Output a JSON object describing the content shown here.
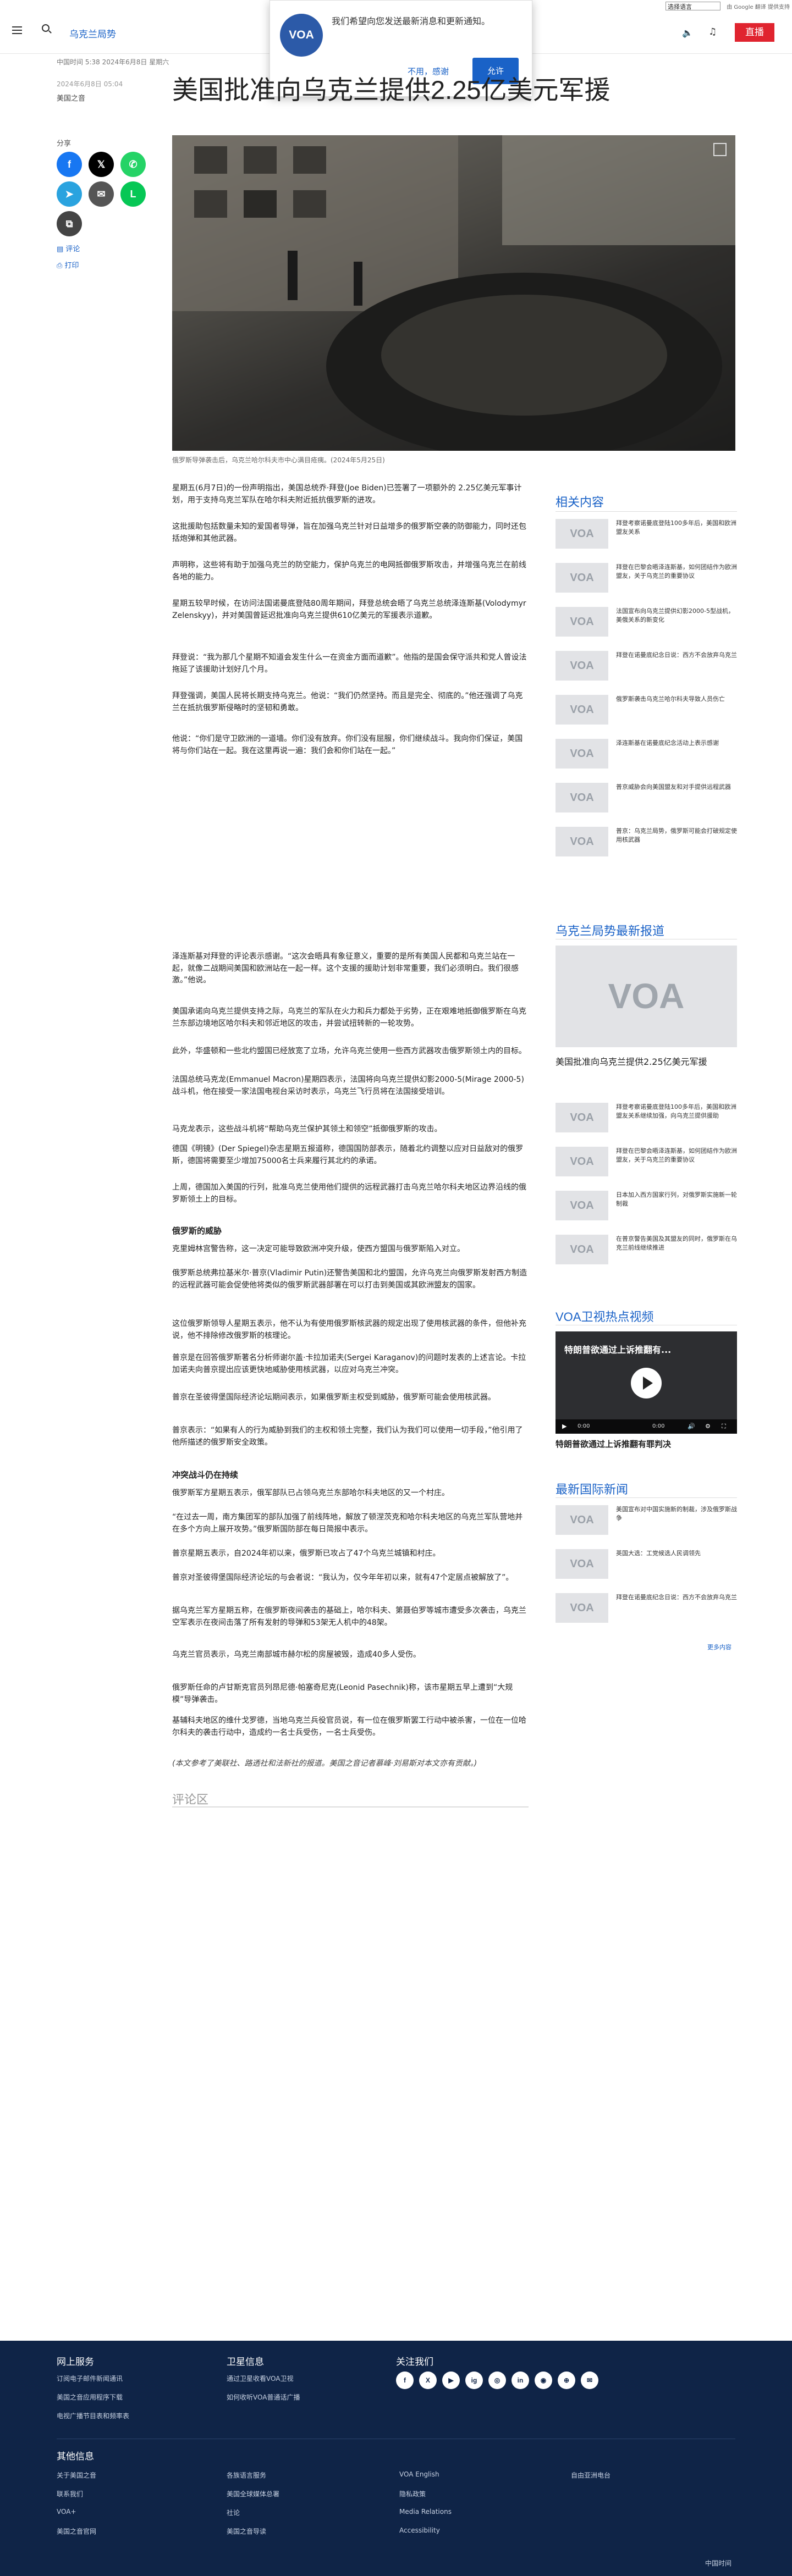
{
  "utility": {
    "language_select": "选择语言",
    "google_translate": "由 Google 翻译 提供支持"
  },
  "header": {
    "section_title": "乌克兰局势",
    "live_label": "直播"
  },
  "notification": {
    "logo": "VOA",
    "message": "我们希望向您发送最新消息和更新通知。",
    "deny_label": "不用，感谢",
    "allow_label": "允许"
  },
  "article": {
    "time_note": "中国时间 5:38 2024年6月8日 星期六",
    "pubdate": "2024年6月8日 05:04",
    "byline": "美国之音",
    "title": "美国批准向乌克兰提供2.25亿美元军援",
    "share_label": "分享",
    "comment_link": "评论",
    "print_link": "打印",
    "image_caption": "俄罗斯导弹袭击后，乌克兰哈尔科夫市中心满目疮痍。(2024年5月25日)",
    "paragraphs_a": [
      "星期五(6月7日)的一份声明指出，美国总统乔·拜登(Joe Biden)已签署了一项额外的 2.25亿美元军事计划，用于支持乌克兰军队在哈尔科夫附近抵抗俄罗斯的进攻。",
      "这批援助包括数量未知的爱国者导弹，旨在加强乌克兰针对日益增多的俄罗斯空袭的防御能力，同时还包括炮弹和其他武器。",
      "声明称，这些将有助于加强乌克兰的防空能力，保护乌克兰的电网抵御俄罗斯攻击，并增强乌克兰在前线各地的能力。",
      "星期五较早时候，在访问法国诺曼底登陆80周年期间，拜登总统会晤了乌克兰总统泽连斯基(Volodymyr Zelenskyy)，并对美国曾延迟批准向乌克兰提供610亿美元的军援表示道歉。",
      "拜登说：“我为那几个星期不知道会发生什么一在资金方面而道歉”。他指的是国会保守派共和党人曾设法拖延了该援助计划好几个月。",
      "拜登强调，美国人民将长期支持乌克兰。他说：“我们仍然坚持。而且是完全、彻底的。”他还强调了乌克兰在抵抗俄罗斯侵略时的坚韧和勇敢。",
      "他说：“你们是守卫欧洲的一道墙。你们没有放弃。你们没有屈服，你们继续战斗。我向你们保证，美国将与你们站在一起。我在这里再说一遍：我们会和你们站在一起。”"
    ],
    "paragraphs_b": [
      "泽连斯基对拜登的评论表示感谢。“这次会晤具有象征意义，重要的是所有美国人民都和乌克兰站在一起，就像二战期间美国和欧洲站在一起一样。这个支援的援助计划非常重要，我们必须明白。我们很感激。”他说。",
      "美国承诺向乌克兰提供支持之际，乌克兰的军队在火力和兵力都处于劣势，正在艰难地抵御俄罗斯在乌克兰东部边境地区哈尔科夫和邻近地区的攻击，并尝试扭转新的一轮攻势。",
      "此外，华盛顿和一些北约盟国已经放宽了立场，允许乌克兰使用一些西方武器攻击俄罗斯领土内的目标。",
      "法国总统马克龙(Emmanuel Macron)星期四表示，法国将向乌克兰提供幻影2000-5(Mirage 2000-5)战斗机，他在接受一家法国电视台采访时表示，乌克兰飞行员将在法国接受培训。",
      "马克龙表示，这些战斗机将“帮助乌克兰保护其领土和领空”抵御俄罗斯的攻击。",
      "德国《明镜》(Der Spiegel)杂志星期五报道称，德国国防部表示，随着北约调整以应对日益敌对的俄罗斯，德国将需要至少增加75000名士兵来履行其北约的承诺。",
      "上周，德国加入美国的行列，批准乌克兰使用他们提供的远程武器打击乌克兰哈尔科夫地区边界沿线的俄罗斯领土上的目标。"
    ],
    "h_threat": "俄罗斯的威胁",
    "paragraphs_c": [
      "克里姆林宫警告称，这一决定可能导致欧洲冲突升级，使西方盟国与俄罗斯陷入对立。",
      "俄罗斯总统弗拉基米尔·普京(Vladimir Putin)还警告美国和北约盟国，允许乌克兰向俄罗斯发射西方制造的远程武器可能会促使他将类似的俄罗斯武器部署在可以打击到美国或其欧洲盟友的国家。",
      "这位俄罗斯领导人星期五表示，他不认为有使用俄罗斯核武器的规定出现了使用核武器的条件，但他补充说，他不排除修改俄罗斯的核理论。",
      "普京是在回答俄罗斯著名分析师谢尔盖·卡拉加诺夫(Sergei Karaganov)的问题时发表的上述言论。卡拉加诺夫向普京提出应该更快地威胁使用核武器，以应对乌克兰冲突。",
      "普京在圣彼得堡国际经济论坛期间表示，如果俄罗斯主权受到威胁，俄罗斯可能会使用核武器。",
      "普京表示：“如果有人的行为威胁到我们的主权和领土完整，我们认为我们可以使用一切手段，”他引用了他所描述的俄罗斯安全政策。"
    ],
    "h_fighting": "冲突战斗仍在持续",
    "paragraphs_d": [
      "俄罗斯军方星期五表示，俄军部队已占领乌克兰东部哈尔科夫地区的又一个村庄。",
      "“在过去一周，南方集团军的部队加强了前线阵地，解放了顿涅茨克和哈尔科夫地区的乌克兰军队营地并在多个方向上展开攻势。”俄罗斯国防部在每日简报中表示。",
      "普京星期五表示，自2024年初以来，俄罗斯已攻占了47个乌克兰城镇和村庄。",
      "普京对圣彼得堡国际经济论坛的与会者说：“我认为，仅今年年初以来，就有47个定居点被解放了”。",
      "据乌克兰军方星期五称，在俄罗斯夜间袭击的基础上，哈尔科夫、第聂伯罗等城市遭受多次袭击，乌克兰空军表示在夜间击落了所有发射的导弹和53架无人机中的48架。",
      "乌克兰官员表示，乌克兰南部城市赫尔松的房屋被毁，造成40多人受伤。",
      "俄罗斯任命的卢甘斯克官员列昂尼德·帕塞奇尼克(Leonid Pasechnik)称，该市星期五早上遭到“大规模”导弹袭击。",
      "基辅科夫地区的维什戈罗德，当地乌克兰兵役官员说，有一位在俄罗斯罢工行动中被杀害，一位在一位哈尔科夫的袭击行动中，造成约一名士兵受伤，一名士兵受伤。"
    ],
    "source_note": "(本文参考了美联社、路透社和法新社的报道。美国之音记者慕峰·刘易斯对本文亦有贡献。)",
    "comments_label": "评论区"
  },
  "sidebar": {
    "related_heading": "相关内容",
    "related": [
      "拜登考察诺曼底登陆100多年后，美国和欧洲盟友关系",
      "拜登在巴黎会晤泽连斯基，如何团结作为欧洲盟友，关于乌克兰的重要协议",
      "法国宣布向乌克兰提供幻影2000-5型战机，美俄关系的新变化",
      "拜登在诺曼底纪念日说：西方不会放弃乌克兰",
      "俄罗斯袭击乌克兰哈尔科夫导致人员伤亡",
      "泽连斯基在诺曼底纪念活动上表示感谢",
      "普京威胁会向美国盟友和对手提供远程武器",
      "普京：乌克兰局势，俄罗斯可能会打破规定使用核武器"
    ],
    "latest_heading": "乌克兰局势最新报道",
    "latest_lead_logo": "VOA",
    "latest_lead_title": "美国批准向乌克兰提供2.25亿美元军援",
    "latest": [
      "拜登考察诺曼底登陆100多年后，美国和欧洲盟友关系继续加强，向乌克兰提供援助",
      "拜登在巴黎会晤泽连斯基，如何团结作为欧洲盟友，关于乌克兰的重要协议",
      "日本加入西方国家行列，对俄罗斯实施新一轮制裁",
      "在普京警告美国及其盟友的同时，俄罗斯在乌克兰前线继续推进"
    ],
    "video_heading": "VOA卫视热点视频",
    "video_title": "特朗普欲通过上诉推翻有...",
    "video_time": "0:00",
    "video_duration": "0:00",
    "video_caption": "特朗普欲通过上诉推翻有罪判决",
    "intl_heading": "最新国际新闻",
    "intl": [
      "美国宣布对中国实施新的制裁，涉及俄罗斯战争",
      "英国大选：工党候选人民调领先",
      "拜登在诺曼底纪念日说：西方不会放弃乌克兰"
    ],
    "more_label": "更多内容",
    "thumb_logo": "VOA"
  },
  "footer": {
    "col1_heading": "网上服务",
    "col1": [
      "订阅电子邮件新闻通讯",
      "美国之音应用程序下载",
      "电视广播节目表和频率表"
    ],
    "col2_heading": "卫星信息",
    "col2": [
      "通过卫星收看VOA卫视",
      "如何收听VOA普通话广播"
    ],
    "col3_heading": "关注我们",
    "social": [
      "f",
      "X",
      "▶",
      "ig",
      "◎",
      "in",
      "◉",
      "⊕",
      "✉"
    ],
    "other_heading": "其他信息",
    "other_col1": [
      "关于美国之音",
      "联系我们",
      "VOA+",
      "美国之音官网"
    ],
    "other_col2": [
      "各族语言服务",
      "美国全球媒体总署",
      "社论",
      "美国之音导读"
    ],
    "other_col3": [
      "VOA English",
      "隐私政策",
      "Media Relations",
      "Accessibility"
    ],
    "other_col4": [
      "自由亚洲电台"
    ],
    "bottom_right": "中国时间"
  }
}
